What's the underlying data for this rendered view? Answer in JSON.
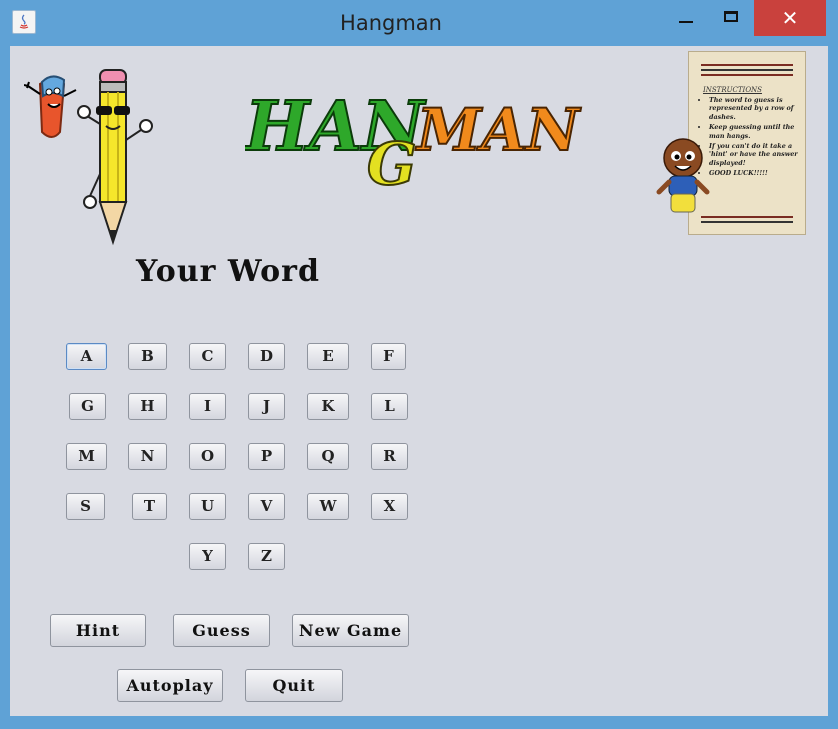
{
  "window": {
    "title": "Hangman",
    "close_glyph": "✕"
  },
  "logo": {
    "part1": "HAN",
    "part2": "G",
    "part3": "MAN",
    "colors": {
      "green": "#2ea82a",
      "yellow": "#e3e021",
      "orange": "#f18a1c"
    }
  },
  "instructions": {
    "title": "INSTRUCTIONS",
    "items": [
      "The word to guess is represented by a row of dashes.",
      "Keep guessing until the man hangs.",
      "If you can't do it take a 'hint' or have the answer displayed!",
      "GOOD LUCK!!!!!"
    ]
  },
  "game": {
    "word_label": "Your Word"
  },
  "keyboard": {
    "keys": [
      "A",
      "B",
      "C",
      "D",
      "E",
      "F",
      "G",
      "H",
      "I",
      "J",
      "K",
      "L",
      "M",
      "N",
      "O",
      "P",
      "Q",
      "R",
      "S",
      "T",
      "U",
      "V",
      "W",
      "X",
      "Y",
      "Z"
    ]
  },
  "actions": {
    "hint": "Hint",
    "guess": "Guess",
    "new_game": "New Game",
    "autoplay": "Autoplay",
    "quit": "Quit"
  },
  "icons": [
    "java-app-icon",
    "minimize-icon",
    "maximize-icon",
    "close-icon",
    "eraser-mascot-icon",
    "pencil-mascot-icon",
    "kid-mascot-icon"
  ]
}
